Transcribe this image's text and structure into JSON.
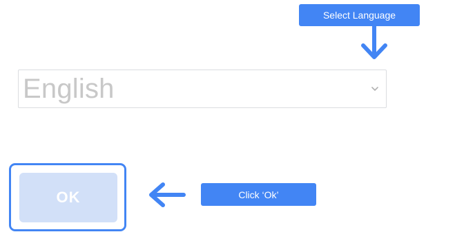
{
  "callouts": {
    "select_language": "Select Language",
    "click_ok": "Click ‘Ok’"
  },
  "language_select": {
    "value": "English"
  },
  "ok_button": {
    "label": "OK"
  },
  "colors": {
    "accent": "#4285F4",
    "ok_button_bg": "#d2e0f8",
    "select_text": "#c8c8c8",
    "select_border": "#dadce0"
  },
  "icons": {
    "select_chevron": "chevron-down-icon",
    "down_arrow": "arrow-down-icon",
    "left_arrow": "arrow-left-icon"
  }
}
